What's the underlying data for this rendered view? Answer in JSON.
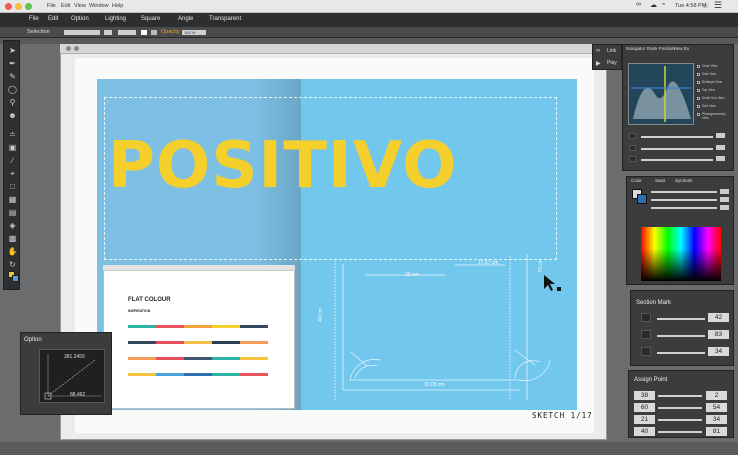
{
  "mac": {
    "menu": [
      "File",
      "Edit",
      "View",
      "Window",
      "Help"
    ],
    "time": "Tue 4:58 PM"
  },
  "app_menu": [
    "File",
    "Edit",
    "Option",
    "Lighting",
    "Square",
    "Angle",
    "Transparent"
  ],
  "options_bar": {
    "selection_label": "Selection",
    "opacity_label": "Opacity",
    "opacity_value": "100 %"
  },
  "canvas": {
    "headline": "POSITIVO",
    "sketch_label": "SKETCH 1/17",
    "dimensions": [
      "20 cm",
      "17.67 cm",
      "70 cm",
      "40 cm",
      "30.05 cm"
    ]
  },
  "inner_window": {
    "title": "FLAT COLOUR",
    "subtitle": "INSPIRATION",
    "colors": [
      "#2bb3a3",
      "#e8555c",
      "#f2a23c",
      "#f3cf2e",
      "#34495e",
      "#e74c5f",
      "#f5c04a",
      "#2d3e50",
      "#f39c5a",
      "#e84f5a",
      "#3f5870",
      "#2db3a5",
      "#f5c33c",
      "#4ca3d8",
      "#2f6fb0"
    ]
  },
  "link_panel": {
    "link_label": "Link",
    "play_label": "Play"
  },
  "navigator": {
    "tabs": [
      "Navigator",
      "Rank Position",
      "View Ex"
    ],
    "checks": [
      "Clear View",
      "Side View",
      "Birdseye View",
      "Top View",
      "Aerial Sun View",
      "Grid View",
      "Photogrammetry View"
    ]
  },
  "color_panel": {
    "tabs": [
      "Color",
      "Swat",
      "Symbols"
    ]
  },
  "option_panel": {
    "title": "Option",
    "top_value": "381.2455",
    "bottom_value": "88.462"
  },
  "section_mark": {
    "title": "Section Mark",
    "values": [
      "42",
      "83",
      "34"
    ]
  },
  "assign_point": {
    "title": "Assign Point",
    "left": [
      "38",
      "60",
      "21",
      "40"
    ],
    "right": [
      "2",
      "54",
      "34",
      "81"
    ]
  }
}
